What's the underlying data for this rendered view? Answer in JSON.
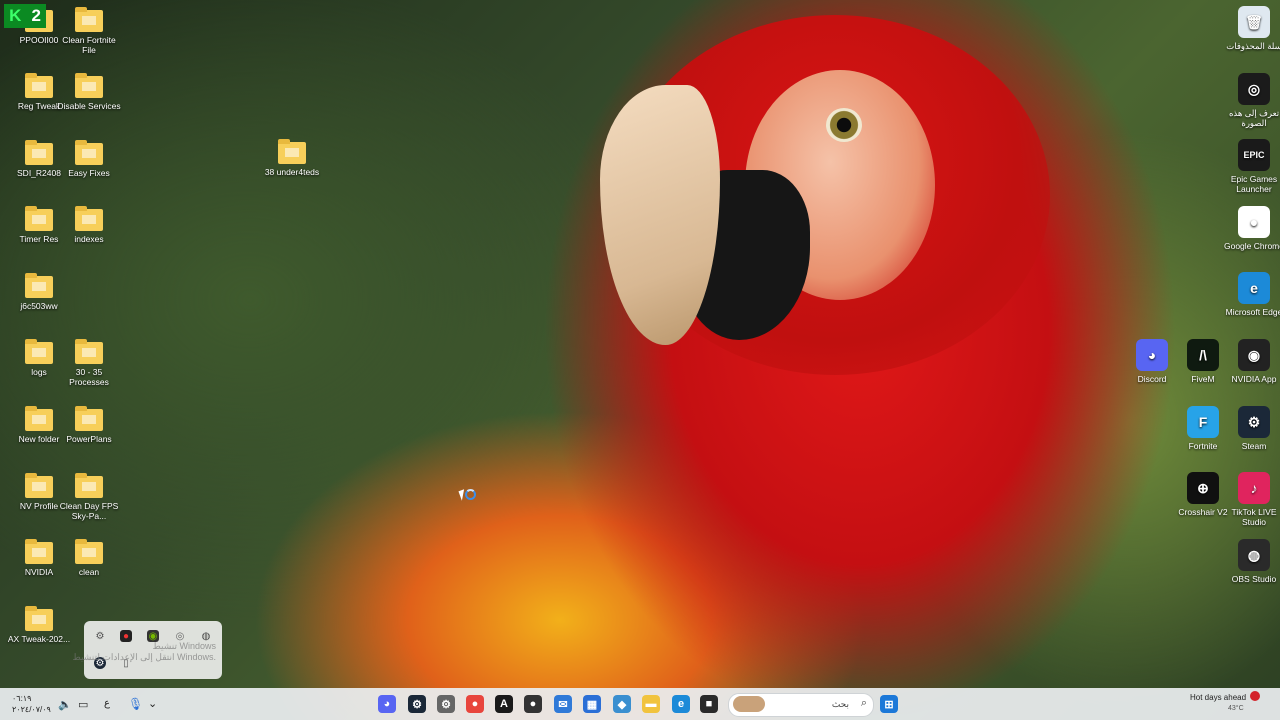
{
  "k2_badge": {
    "letter": "K",
    "number": "2"
  },
  "left_icons": [
    {
      "label": "PPOOII00",
      "icon": "folder-icon"
    },
    {
      "label": "Clean Fortnite File",
      "icon": "folder-icon"
    },
    {
      "label": "Reg Tweak",
      "icon": "folder-icon"
    },
    {
      "label": "Disable Services",
      "icon": "folder-icon"
    },
    {
      "label": "SDI_R2408",
      "icon": "folder-icon"
    },
    {
      "label": "Easy Fixes",
      "icon": "folder-icon"
    },
    {
      "label": "Timer Res",
      "icon": "folder-icon"
    },
    {
      "label": "indexes",
      "icon": "folder-icon"
    },
    {
      "label": "j6c503ww",
      "icon": "folder-icon"
    },
    {
      "label": "logs",
      "icon": "folder-icon"
    },
    {
      "label": "30 - 35 Processes",
      "icon": "folder-icon"
    },
    {
      "label": "New folder",
      "icon": "folder-icon"
    },
    {
      "label": "PowerPlans",
      "icon": "folder-icon"
    },
    {
      "label": "NV Profile",
      "icon": "folder-icon"
    },
    {
      "label": "Clean Day FPS Sky-Pa...",
      "icon": "folder-icon"
    },
    {
      "label": "NVIDIA",
      "icon": "folder-icon"
    },
    {
      "label": "clean",
      "icon": "folder-icon"
    },
    {
      "label": "AX Tweak-202...",
      "icon": "folder-icon"
    },
    {
      "label": "38 under4teds",
      "icon": "folder-icon"
    }
  ],
  "right_icons": [
    {
      "label": "سلة المحذوفات",
      "icon": "recycle-bin-icon",
      "glyph": "🗑",
      "color": "#dfe8f0"
    },
    {
      "label": "تعرف إلى هذه الصورة",
      "icon": "camera-info-icon",
      "glyph": "◎",
      "color": "#1b1b1b"
    },
    {
      "label": "Epic Games Launcher",
      "icon": "epic-games-icon",
      "glyph": "EPIC",
      "color": "#1a1a1a"
    },
    {
      "label": "Google Chrome",
      "icon": "chrome-icon",
      "glyph": "●",
      "color": "#ffffff"
    },
    {
      "label": "Microsoft Edge",
      "icon": "edge-icon",
      "glyph": "e",
      "color": "#1c8ad8"
    },
    {
      "label": "Discord",
      "icon": "discord-icon",
      "glyph": "◕",
      "color": "#5865f2"
    },
    {
      "label": "FiveM",
      "icon": "fivem-icon",
      "glyph": "/\\",
      "color": "#0f1a10"
    },
    {
      "label": "NVIDIA App",
      "icon": "nvidia-icon",
      "glyph": "◉",
      "color": "#222222"
    },
    {
      "label": "Fortnite",
      "icon": "fortnite-icon",
      "glyph": "F",
      "color": "#27a3e8"
    },
    {
      "label": "Steam",
      "icon": "steam-icon",
      "glyph": "⚙",
      "color": "#1b2838"
    },
    {
      "label": "Crosshair V2",
      "icon": "crosshair-icon",
      "glyph": "⊕",
      "color": "#101010"
    },
    {
      "label": "TikTok LIVE Studio",
      "icon": "tiktok-icon",
      "glyph": "♪",
      "color": "#e0245e"
    },
    {
      "label": "OBS Studio",
      "icon": "obs-icon",
      "glyph": "◍",
      "color": "#2a2a2a"
    }
  ],
  "tray_popup": {
    "icons": [
      "gear-icon",
      "app-icon",
      "nvidia-icon",
      "controller-icon",
      "circle-icon",
      "steam-icon",
      "clipboard-icon"
    ]
  },
  "watermark": {
    "line1": "تنشيط Windows",
    "line2": "انتقل إلى الإعدادات لتنشيط Windows."
  },
  "taskbar": {
    "left_time": "٠٦:١٩",
    "left_date": "٢٠٢٤/٠٧/٠٩",
    "search_placeholder": "بحث",
    "weather_title": "Hot days ahead",
    "weather_temp": "43°C",
    "pinned": [
      {
        "name": "discord-taskbar-icon",
        "glyph": "◕",
        "color": "#5865f2"
      },
      {
        "name": "steam-taskbar-icon",
        "glyph": "⚙",
        "color": "#1b2838"
      },
      {
        "name": "settings-taskbar-icon",
        "glyph": "⚙",
        "color": "#666666"
      },
      {
        "name": "chrome-taskbar-icon",
        "glyph": "●",
        "color": "#e8453c"
      },
      {
        "name": "fivem-taskbar-icon",
        "glyph": "A",
        "color": "#1a1a1a"
      },
      {
        "name": "app-taskbar-icon",
        "glyph": "●",
        "color": "#333333"
      },
      {
        "name": "mail-taskbar-icon",
        "glyph": "✉",
        "color": "#2f7ad8"
      },
      {
        "name": "store-taskbar-icon",
        "glyph": "▦",
        "color": "#2b6fd6"
      },
      {
        "name": "shield-taskbar-icon",
        "glyph": "◆",
        "color": "#3a8fd0"
      },
      {
        "name": "file-explorer-taskbar-icon",
        "glyph": "▬",
        "color": "#f1c33e"
      },
      {
        "name": "edge-taskbar-icon",
        "glyph": "e",
        "color": "#1c8ad8"
      },
      {
        "name": "terminal-taskbar-icon",
        "glyph": "■",
        "color": "#2a2a2a"
      }
    ]
  }
}
